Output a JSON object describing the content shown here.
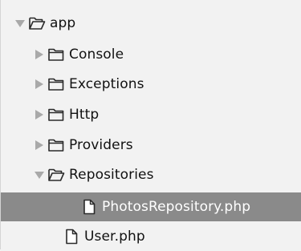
{
  "tree": {
    "root": {
      "label": "app",
      "expanded": true,
      "arrow_icon": "triangle-down-icon",
      "icon": "folder-open-icon"
    },
    "items": [
      {
        "label": "Console",
        "expanded": false,
        "arrow_icon": "triangle-right-icon",
        "icon": "folder-icon"
      },
      {
        "label": "Exceptions",
        "expanded": false,
        "arrow_icon": "triangle-right-icon",
        "icon": "folder-icon"
      },
      {
        "label": "Http",
        "expanded": false,
        "arrow_icon": "triangle-right-icon",
        "icon": "folder-icon"
      },
      {
        "label": "Providers",
        "expanded": false,
        "arrow_icon": "triangle-right-icon",
        "icon": "folder-icon"
      },
      {
        "label": "Repositories",
        "expanded": true,
        "arrow_icon": "triangle-down-icon",
        "icon": "folder-open-icon"
      },
      {
        "label": "PhotosRepository.php",
        "selected": true,
        "icon": "file-icon"
      },
      {
        "label": "User.php",
        "selected": false,
        "icon": "file-icon"
      }
    ]
  },
  "colors": {
    "background": "#f2f2f2",
    "selected_row": "#8a8a8a",
    "arrow": "#a9a9a9",
    "icon_stroke": "#2a2a2a",
    "text": "#111111",
    "selected_text": "#ffffff"
  }
}
